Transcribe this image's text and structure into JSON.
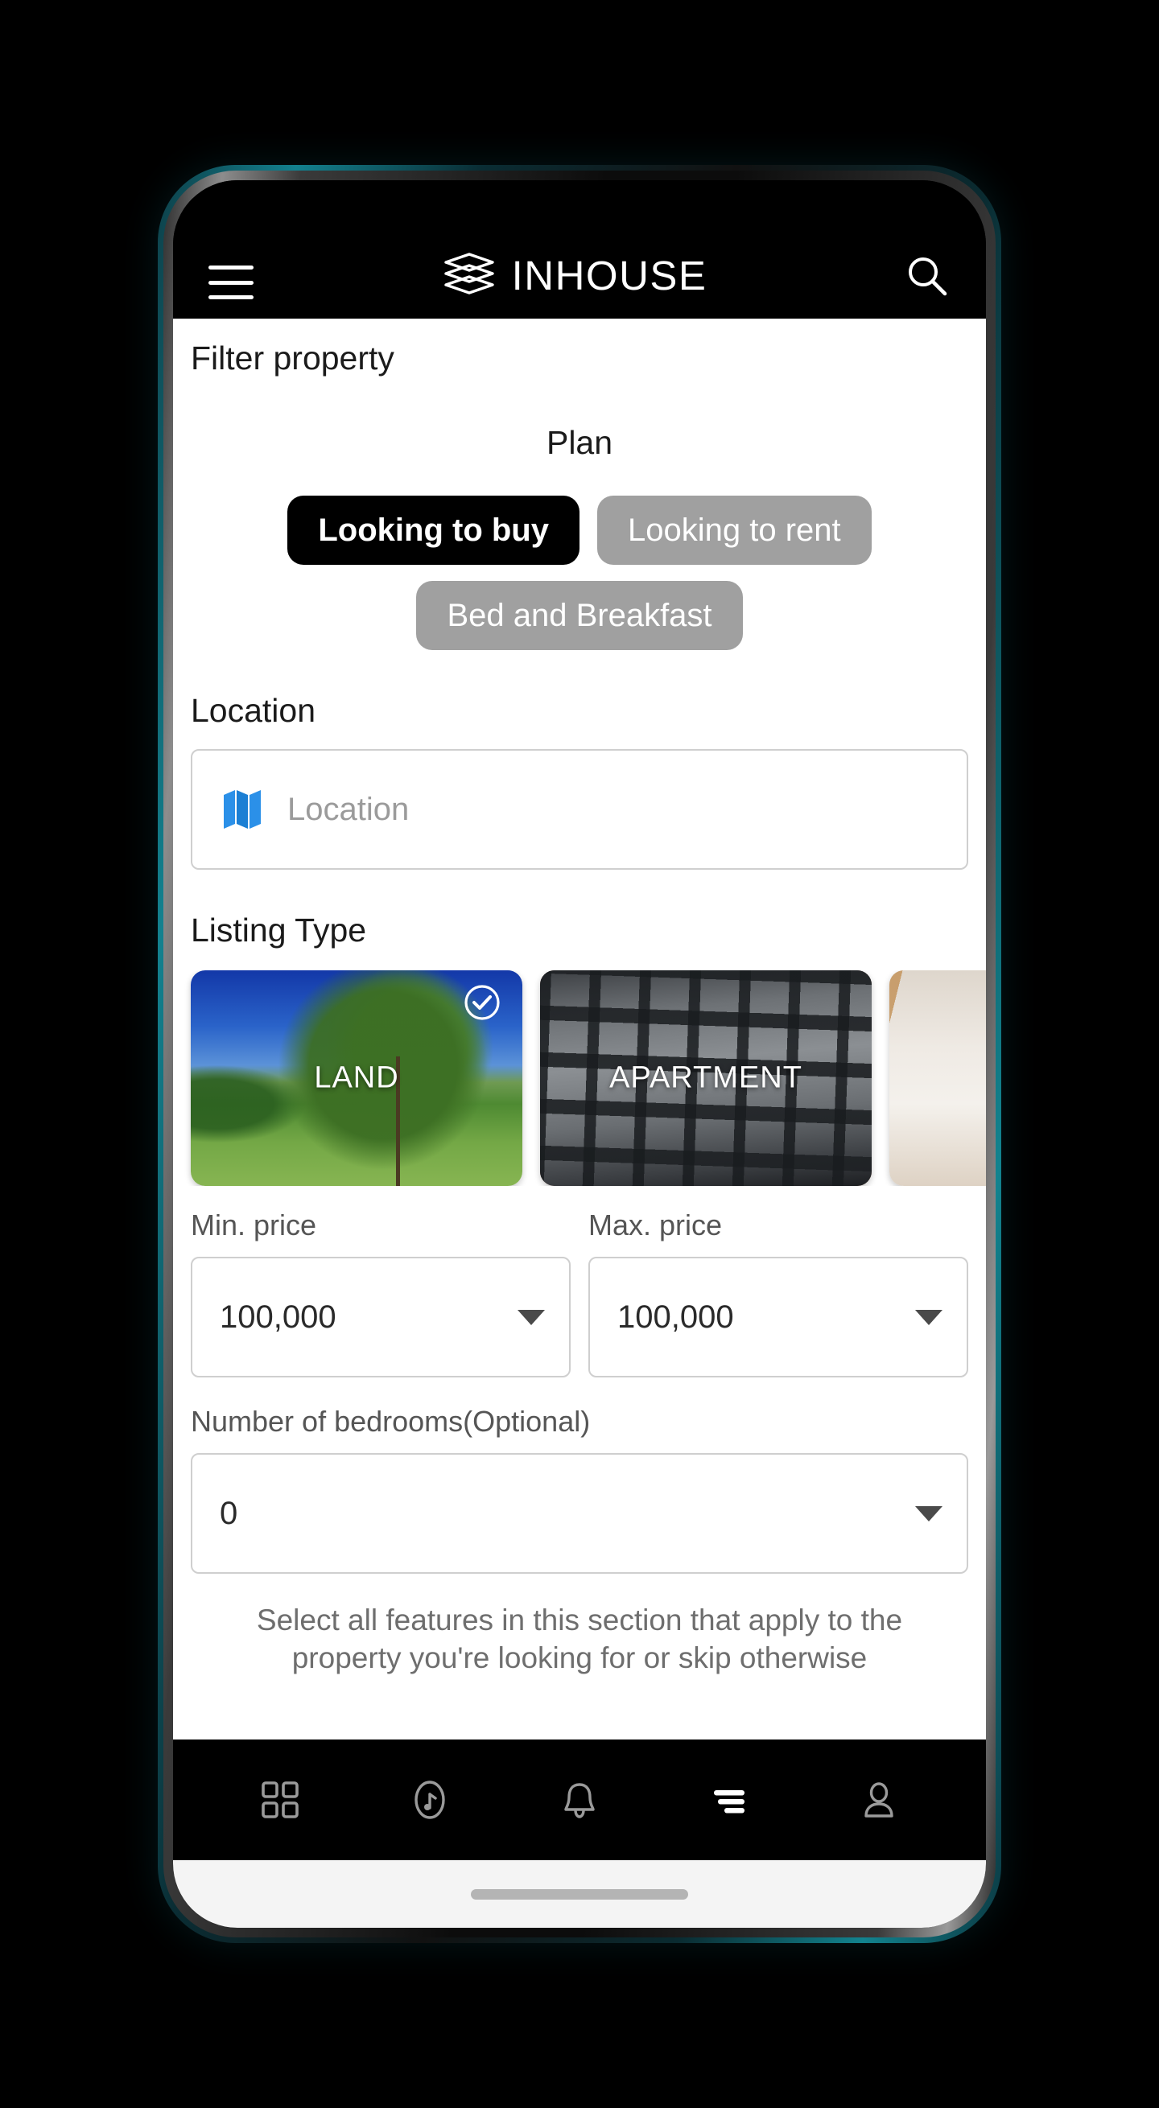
{
  "app": {
    "brand_name": "INHOUSE",
    "logo_icon": "layers-stack-icon",
    "menu_icon": "hamburger-menu-icon",
    "search_icon": "search-icon"
  },
  "screen": {
    "title": "Filter property"
  },
  "plan": {
    "label": "Plan",
    "options": [
      {
        "label": "Looking to buy",
        "selected": true
      },
      {
        "label": "Looking to rent",
        "selected": false
      },
      {
        "label": "Bed and Breakfast",
        "selected": false
      }
    ]
  },
  "location": {
    "label": "Location",
    "icon": "map-icon",
    "value": "",
    "placeholder": "Location"
  },
  "listing_type": {
    "label": "Listing Type",
    "cards": [
      {
        "label": "LAND",
        "selected": true,
        "check_icon": "check-circle-icon",
        "art": "art-land"
      },
      {
        "label": "APARTMENT",
        "selected": false,
        "art": "art-apt"
      },
      {
        "label": "",
        "selected": false,
        "art": "art-loft"
      }
    ]
  },
  "price": {
    "min_label": "Min. price",
    "min_value": "100,000",
    "max_label": "Max. price",
    "max_value": "100,000",
    "caret_icon": "chevron-down-icon"
  },
  "bedrooms": {
    "label": "Number of bedrooms(Optional)",
    "value": "0",
    "caret_icon": "chevron-down-icon"
  },
  "helper": {
    "text": "Select all features in this section that apply to the property you're looking for or skip otherwise"
  },
  "bottom_nav": {
    "items": [
      {
        "name": "dashboard-grid-icon",
        "active": false
      },
      {
        "name": "upload-circle-icon",
        "active": false
      },
      {
        "name": "bell-icon",
        "active": false
      },
      {
        "name": "filter-icon",
        "active": true
      },
      {
        "name": "person-icon",
        "active": false
      }
    ]
  },
  "colors": {
    "accent_blue": "#2b90e8",
    "selected_pill": "#000000",
    "unselected_pill": "#a0a0a0",
    "app_bar": "#000000",
    "border": "#cfcfcf",
    "device_edge_teal": "#12828f"
  }
}
